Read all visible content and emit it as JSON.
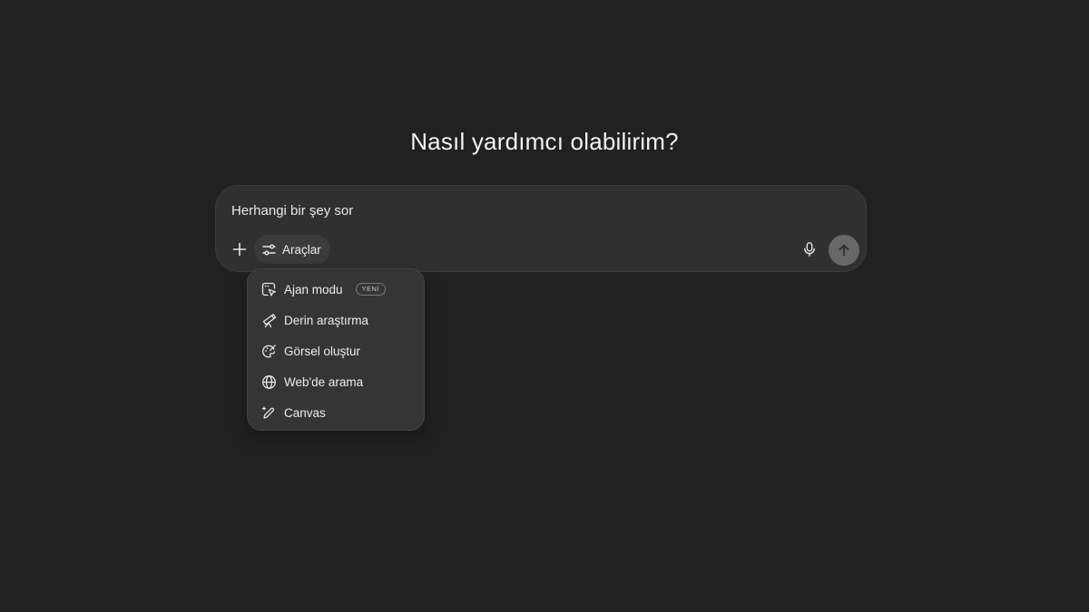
{
  "heading": "Nasıl yardımcı olabilirim?",
  "composer": {
    "placeholder": "Herhangi bir şey sor",
    "tools_label": "Araçlar",
    "icons": {
      "add": "plus-icon",
      "tools": "sliders-icon",
      "mic": "microphone-icon",
      "send": "arrow-up-icon"
    }
  },
  "tools_menu": {
    "items": [
      {
        "label": "Ajan modu",
        "badge": "YENİ",
        "icon": "agent-cursor-icon"
      },
      {
        "label": "Derin araştırma",
        "icon": "telescope-icon"
      },
      {
        "label": "Görsel oluştur",
        "icon": "palette-icon"
      },
      {
        "label": "Web'de arama",
        "icon": "globe-icon"
      },
      {
        "label": "Canvas",
        "icon": "pencil-sparkle-icon"
      }
    ]
  },
  "colors": {
    "background": "#212121",
    "composer": "#303030",
    "menu": "#353535",
    "send_button": "#676767"
  }
}
